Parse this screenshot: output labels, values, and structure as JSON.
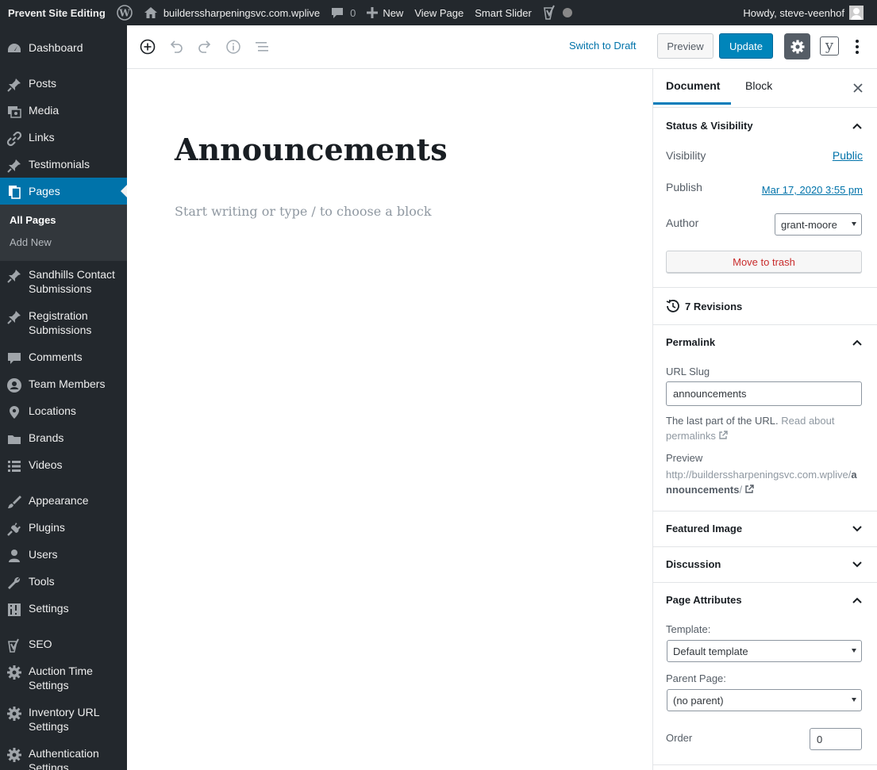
{
  "admin_bar": {
    "site_editing": "Prevent Site Editing",
    "site_name": "builderssharpeningsvc.com.wplive",
    "comments_count": "0",
    "new": "New",
    "view_page": "View Page",
    "smart_slider": "Smart Slider",
    "howdy": "Howdy, steve-veenhof"
  },
  "menu": {
    "dashboard": "Dashboard",
    "posts": "Posts",
    "media": "Media",
    "links": "Links",
    "testimonials": "Testimonials",
    "pages": "Pages",
    "all_pages": "All Pages",
    "add_new": "Add New",
    "sandhills_1": "Sandhills Contact",
    "sandhills_2": "Submissions",
    "registration_1": "Registration",
    "registration_2": "Submissions",
    "comments": "Comments",
    "team_members": "Team Members",
    "locations": "Locations",
    "brands": "Brands",
    "videos": "Videos",
    "appearance": "Appearance",
    "plugins": "Plugins",
    "users": "Users",
    "tools": "Tools",
    "settings": "Settings",
    "seo": "SEO",
    "auction_1": "Auction Time",
    "auction_2": "Settings",
    "inventory_1": "Inventory URL",
    "inventory_2": "Settings",
    "auth_1": "Authentication",
    "auth_2": "Settings"
  },
  "toolbar": {
    "switch_to_draft": "Switch to Draft",
    "preview": "Preview",
    "update": "Update",
    "yoast": "y"
  },
  "editor": {
    "title": "Announcements",
    "appender_placeholder": "Start writing or type / to choose a block"
  },
  "sidebar": {
    "tab_document": "Document",
    "tab_block": "Block",
    "status_visibility": {
      "title": "Status & Visibility",
      "visibility_label": "Visibility",
      "visibility_value": "Public",
      "publish_label": "Publish",
      "publish_value": "Mar 17, 2020 3:55 pm",
      "author_label": "Author",
      "author_value": "grant-moore",
      "move_to_trash": "Move to trash"
    },
    "revisions": "7 Revisions",
    "permalink": {
      "title": "Permalink",
      "slug_label": "URL Slug",
      "slug_value": "announcements",
      "help_text": "The last part of the URL.",
      "read_about": "Read about",
      "permalinks": "permalinks",
      "preview_label": "Preview",
      "preview_url_1": "http://builderssharpeningsvc.com.wplive/",
      "preview_url_slug": "announcements",
      "preview_url_end": "/"
    },
    "featured_image": "Featured Image",
    "discussion": "Discussion",
    "page_attributes": {
      "title": "Page Attributes",
      "template_label": "Template:",
      "template_value": "Default template",
      "parent_label": "Parent Page:",
      "parent_value": "(no parent)",
      "order_label": "Order",
      "order_value": "0"
    }
  },
  "colors": {
    "admin_dark": "#23282d",
    "primary_blue": "#0073aa",
    "update_blue": "#0085ba",
    "trash_red": "#c92c2c"
  }
}
